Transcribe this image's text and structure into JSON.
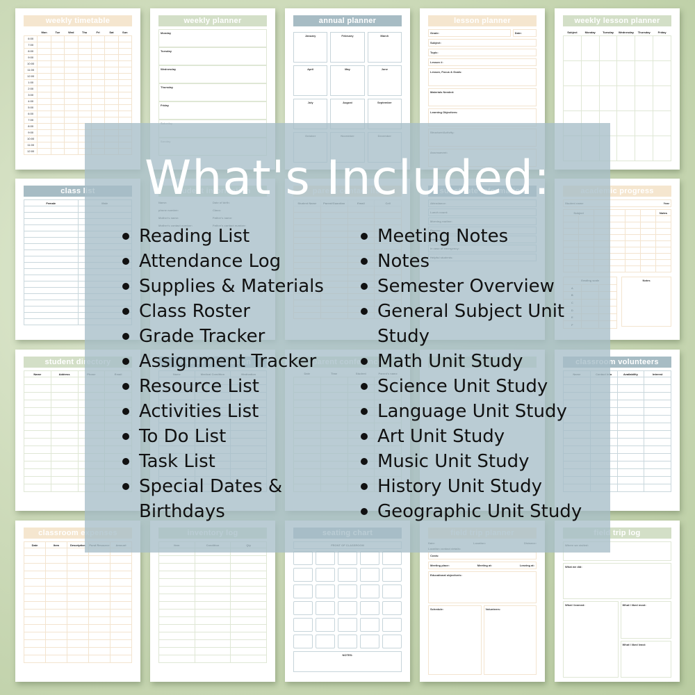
{
  "overlay": {
    "title": "What's Included:",
    "left_items": [
      "Reading List",
      "Attendance Log",
      "Supplies & Materials",
      "Class Roster",
      "Grade Tracker",
      "Assignment Tracker",
      "Resource List",
      "Activities List",
      "To Do List",
      "Task List",
      "Special Dates & Birthdays"
    ],
    "right_items": [
      "Meeting Notes",
      "Notes",
      "Semester Overview",
      "General Subject Unit Study",
      "Math Unit Study",
      "Science Unit Study",
      "Language Unit Study",
      "Art Unit Study",
      "Music Unit Study",
      "History Unit Study",
      "Geographic Unit Study"
    ]
  },
  "pages": {
    "weekly_timetable": {
      "title": "weekly timetable",
      "days": [
        "Mon",
        "Tue",
        "Wed",
        "Thu",
        "Fri",
        "Sat",
        "Sun"
      ],
      "times": [
        "6:00",
        "7:00",
        "8:00",
        "9:00",
        "10:00",
        "11:00",
        "12:00",
        "1:00",
        "2:00",
        "3:00",
        "4:00",
        "5:00",
        "6:00",
        "7:00",
        "8:00",
        "9:00",
        "10:00",
        "11:00",
        "12:00"
      ]
    },
    "weekly_planner": {
      "title": "weekly planner",
      "days": [
        "Monday",
        "Tuesday",
        "Wednesday",
        "Thursday",
        "Friday",
        "Saturday",
        "Sunday"
      ]
    },
    "annual_planner": {
      "title": "annual planner",
      "months": [
        "January",
        "February",
        "March",
        "April",
        "May",
        "June",
        "July",
        "August",
        "September",
        "October",
        "November",
        "December"
      ]
    },
    "lesson_planner": {
      "title": "lesson planner",
      "fields": [
        "Grade:",
        "Date:",
        "Subject:",
        "Topic:",
        "Lesson #:"
      ],
      "sections": [
        "Lesson, Focus & Goals:",
        "Materials Needed:",
        "Learning Objectives:",
        "Structure/Activity:",
        "Assessment:"
      ]
    },
    "weekly_lesson_planner": {
      "title": "weekly lesson planner",
      "columns": [
        "Subject",
        "Monday",
        "Tuesday",
        "Wednesday",
        "Thursday",
        "Friday"
      ]
    },
    "class_list": {
      "title": "class list",
      "columns": [
        "Female",
        "Male"
      ]
    },
    "student_information": {
      "title": "student information",
      "fields": [
        "Name:",
        "Date of birth:",
        "phone number:",
        "Class:",
        "Mother's name:",
        "Father's name:",
        "Mother's contact number:",
        "Father's contact number:",
        "Notes:"
      ]
    },
    "parent_contact_list": {
      "title": "parent contact list",
      "columns": [
        "Student Name",
        "Parent/Guardian",
        "Email",
        "Cell"
      ]
    },
    "substitute_information": {
      "title": "substitute information",
      "fields": [
        "Attendance:",
        "Lunch count:",
        "Morning routine:",
        "Recess:",
        "Bathrooms:",
        "In case of emergency:",
        "Helpful students:"
      ]
    },
    "academic_progress": {
      "title": "academic progress",
      "fields": [
        "Student name",
        "Year"
      ],
      "subject_label": "Subject",
      "notes_label": "Notes",
      "grading_label": "Grading scale",
      "grades": [
        "A",
        "B",
        "C",
        "D",
        "E",
        "F"
      ]
    },
    "student_directory": {
      "title": "student directory",
      "columns": [
        "Name",
        "Address",
        "Phone",
        "Email"
      ]
    },
    "medical_information": {
      "title": "medical information",
      "columns": [
        "Name",
        "Medical Condition",
        "Medication"
      ]
    },
    "parent_conference": {
      "title": "parent conference",
      "columns": [
        "Date",
        "Time",
        "Student",
        "Parent's name"
      ]
    },
    "classroom_volunteers": {
      "title": "classroom volunteers",
      "columns": [
        "Name",
        "Contact Info",
        "Availability",
        "Interest"
      ]
    },
    "classroom_expenses": {
      "title": "classroom expenses",
      "columns": [
        "Date",
        "Item",
        "Description",
        "Fund Resource",
        "Amount"
      ]
    },
    "inventory_log": {
      "title": "inventory log",
      "columns": [
        "Item",
        "Condition",
        "Qty"
      ]
    },
    "seating_chart": {
      "title": "seating chart",
      "front_label": "FRONT OF CLASSROOM",
      "notes_label": "NOTES:"
    },
    "field_trip_planner": {
      "title": "field trip planner",
      "fields": [
        "Date:",
        "Location:",
        "Distance:",
        "Location contact details:",
        "Costs:",
        "Meeting place:",
        "Meeting at:",
        "Leaving at:",
        "Educational objective/s:",
        "Schedule:",
        "Volunteers:"
      ]
    },
    "field_trip_log": {
      "title": "field trip log",
      "fields": [
        "Where we visited:",
        "What we did:",
        "What I learned:",
        "What I liked most:",
        "What I liked least:"
      ]
    }
  }
}
